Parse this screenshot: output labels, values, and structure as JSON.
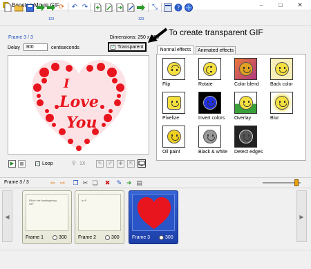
{
  "window": {
    "title": "Beneton Movie GIF"
  },
  "toolbar": {
    "icons": [
      "new-icon",
      "open-icon",
      "save-icon",
      "export-icon",
      "export-frames-icon",
      "rotate-icon",
      "undo-icon",
      "redo-icon",
      "add-frame-icon",
      "insert-frame-icon",
      "import-frames-icon",
      "edit-frame-icon",
      "numbered-frames-icon",
      "resize-icon",
      "preferences-icon",
      "help-icon",
      "about-icon"
    ],
    "badge_123": "123"
  },
  "frame": {
    "label": "Frame 3 / 3",
    "dimensions": "Dimensions: 250 x 250",
    "delay_label": "Delay",
    "delay_value": "300",
    "delay_unit": "centiseconds",
    "transparent_label": "Transparent",
    "transparent_checked": true
  },
  "annotation": {
    "text": "To create transparent GIF"
  },
  "playback": {
    "loop_label": "Loop",
    "loop_checked": true,
    "zoom_text": "1X"
  },
  "effects": {
    "tabs": [
      "Normal effects",
      "Animated effects"
    ],
    "active_tab": "Normal effects",
    "items": [
      {
        "label": "Flip",
        "icon": "flip-smiley-icon"
      },
      {
        "label": "Rotate",
        "icon": "rotate-smiley-icon"
      },
      {
        "label": "Color blend",
        "icon": "color-blend-smiley-icon"
      },
      {
        "label": "Back color",
        "icon": "back-color-smiley-icon"
      },
      {
        "label": "Pixelize",
        "icon": "pixelize-smiley-icon"
      },
      {
        "label": "Invert colors",
        "icon": "invert-smiley-icon"
      },
      {
        "label": "Overlay",
        "icon": "overlay-smiley-icon"
      },
      {
        "label": "Blur",
        "icon": "blur-smiley-icon"
      },
      {
        "label": "Oil paint",
        "icon": "oil-paint-smiley-icon"
      },
      {
        "label": "Black & white",
        "icon": "bw-smiley-icon"
      },
      {
        "label": "Detect edges",
        "icon": "edges-smiley-icon"
      }
    ]
  },
  "strip": {
    "title": "Frame 3 / 3",
    "frames": [
      {
        "name": "Frame 1",
        "delay": "300",
        "preview_text": "Flickr intr thanksgiving\nGIF"
      },
      {
        "name": "Frame 2",
        "delay": "300",
        "preview_text": "In 8"
      },
      {
        "name": "Frame 3",
        "delay": "300",
        "selected": true
      }
    ]
  },
  "colors": {
    "accent": "#1d3fa8",
    "heart": "#e8141e",
    "link": "#1a4fbf"
  },
  "preview": {
    "heart_text_1": "I",
    "heart_text_2": "Love",
    "heart_text_3": "You"
  }
}
